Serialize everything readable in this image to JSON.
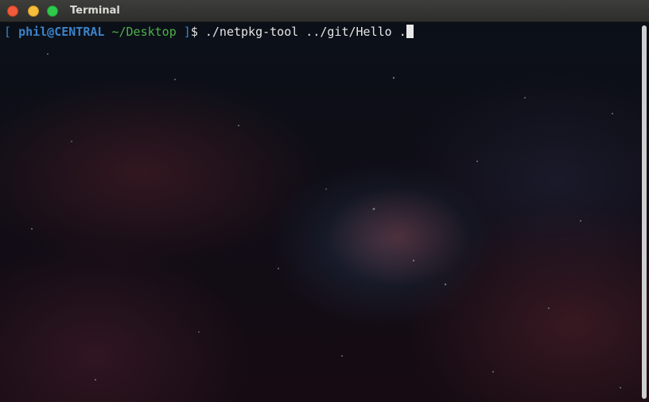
{
  "window": {
    "title": "Terminal"
  },
  "icons": {
    "close": "close-icon",
    "minimize": "minimize-icon",
    "maximize": "maximize-icon"
  },
  "prompt": {
    "open_bracket": "[",
    "user_host": "phil@CENTRAL",
    "cwd": "~/Desktop",
    "close_bracket": "]",
    "symbol": "$",
    "command": "./netpkg-tool ../git/Hello ."
  },
  "colors": {
    "prompt_user": "#3b83c9",
    "prompt_path": "#4fb04a",
    "text": "#e6e6e6"
  }
}
